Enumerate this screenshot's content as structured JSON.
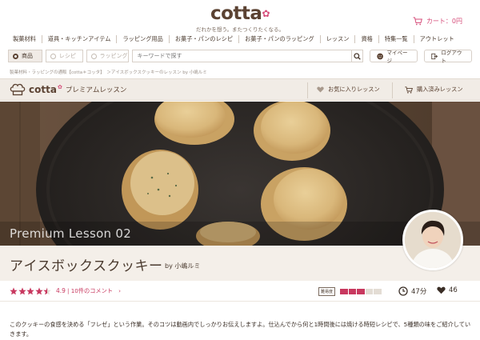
{
  "header": {
    "logo": "cotta",
    "tagline": "だれかを想う。またつくりたくなる。",
    "cart_label": "カート：0円"
  },
  "nav": {
    "items": [
      "製菓材料",
      "道具・キッチンアイテム",
      "ラッピング用品",
      "お菓子・パンのレシピ",
      "お菓子・パンのラッピング",
      "レッスン",
      "資格",
      "特集一覧",
      "アウトレット"
    ]
  },
  "search": {
    "tabs": [
      "商品",
      "レシピ",
      "ラッピング"
    ],
    "active_tab": "商品",
    "placeholder": "キーワードで探す",
    "mypage_label": "マイページ",
    "logout_label": "ログアウト"
  },
  "breadcrumb": "製菓材料・ラッピングの通販【cotta＊コッタ】　＞アイスボックスクッキーのレッスン by 小嶋ルミ",
  "premium_bar": {
    "brand": "cotta",
    "label": "プレミアムレッスン",
    "favorite_label": "お気に入りレッスン",
    "purchased_label": "購入済みレッスン"
  },
  "hero": {
    "overlay_text": "Premium Lesson 02"
  },
  "lesson": {
    "title": "アイスボックスクッキー",
    "author": "by 小嶋ルミ"
  },
  "rating": {
    "value": 4.9,
    "stars": 4.5,
    "value_text": "4.9",
    "comment_text": "| 10件のコメント　›"
  },
  "difficulty": {
    "label": "難易度",
    "level": 3,
    "max": 5
  },
  "stats": {
    "time": "47分",
    "likes": "46"
  },
  "description": "このクッキーの食感を決める「フレゼ」という作業。そのコツは動画内でしっかりお伝えしますよ。仕込んでから何と1時間後には焼ける時短レシピで、5種類の味をご紹介していきます。",
  "colors": {
    "accent": "#c8385f",
    "brown": "#5b4232",
    "band": "#f4efe9"
  },
  "icons": [
    "cart-icon",
    "search-icon",
    "smile-icon",
    "logout-icon",
    "chef-hat-icon",
    "heart-icon",
    "cart-small-icon",
    "star-icon",
    "clock-icon"
  ]
}
